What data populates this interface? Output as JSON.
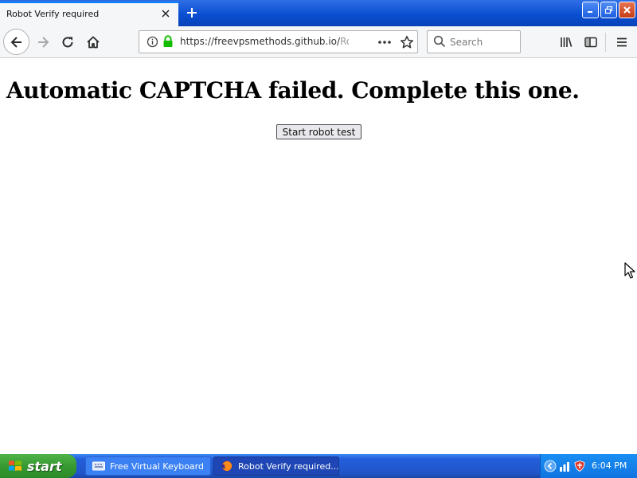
{
  "browser": {
    "tab": {
      "title": "Robot Verify required"
    },
    "url": {
      "main": "https://freevpsmethods.github.io/",
      "faded": "Ro"
    },
    "search": {
      "placeholder": "Search"
    }
  },
  "page": {
    "title": "Automatic CAPTCHA failed. Complete this one.",
    "button_label": "Start robot test"
  },
  "taskbar": {
    "start_label": "start",
    "tasks": [
      {
        "label": "Free Virtual Keyboard"
      },
      {
        "label": "Robot Verify required..."
      }
    ],
    "clock": "6:04 PM"
  },
  "colors": {
    "titlebar": "#0a4fd1",
    "tab_accent": "#0a84ff",
    "start_green": "#379a31",
    "taskbar_blue": "#245edb",
    "lock_green": "#12bc00"
  },
  "icons": [
    "close-icon",
    "plus-icon",
    "back-arrow-icon",
    "forward-arrow-icon",
    "reload-icon",
    "home-icon",
    "info-icon",
    "lock-icon",
    "more-actions-icon",
    "star-icon",
    "search-icon",
    "library-icon",
    "sidebar-icon",
    "hamburger-menu-icon",
    "windows-logo-icon",
    "keyboard-icon",
    "firefox-icon",
    "chevron-left-icon",
    "network-icon",
    "security-shield-icon",
    "mouse-cursor-icon"
  ]
}
